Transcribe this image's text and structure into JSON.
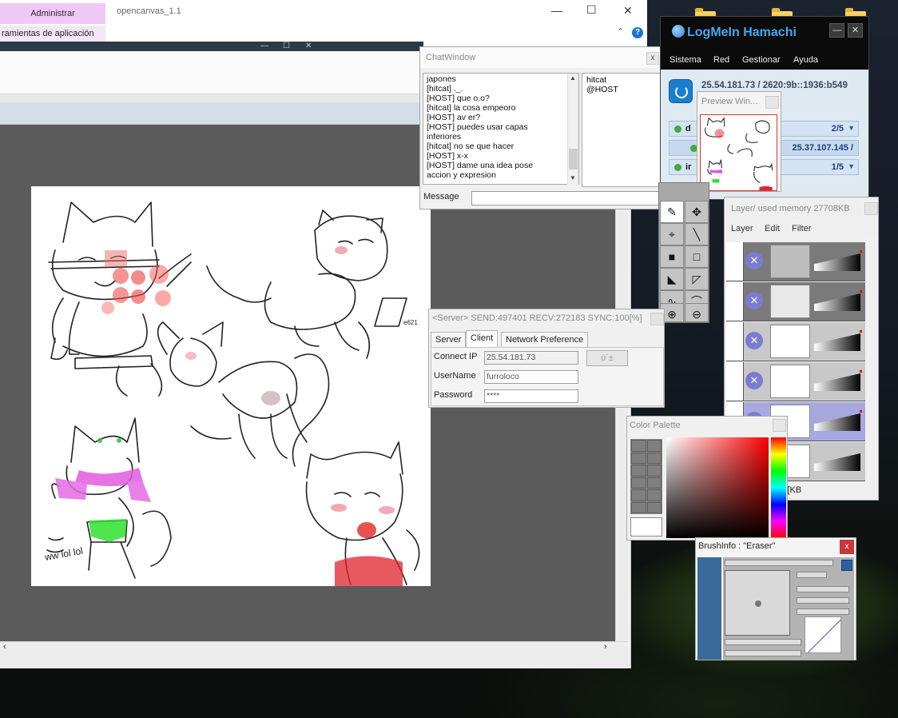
{
  "explorer": {
    "admin_tab": "Administrar",
    "sub_label": "ramientas de aplicación",
    "title": "opencanvas_1.1",
    "minimize": "—",
    "maximize": "☐",
    "close": "✕",
    "help": "?",
    "collapse": "⌃"
  },
  "chat": {
    "title": "ChatWindow",
    "close": "x",
    "messages": [
      "japones",
      "[hitcat] ._.",
      "[HOST]  que o.o?",
      "[hitcat] la cosa empeoro",
      "[HOST] av er?",
      "[HOST] puedes usar capas",
      "inferiores",
      "[hitcat] no se que hacer",
      "[HOST]  x-x",
      "[HOST] dame una idea pose",
      "accion y expresion"
    ],
    "users": [
      "hitcat",
      "@HOST"
    ],
    "message_label": "Message",
    "message_value": ""
  },
  "hamachi": {
    "brand": "LogMeIn Hamachi",
    "minimize": "—",
    "close": "✕",
    "menu": [
      "Sistema",
      "Red",
      "Gestionar",
      "Ayuda"
    ],
    "ip": "25.54.181.73 / 2620:9b::1936:b549",
    "networks": [
      {
        "name": "d",
        "count": "2/5"
      },
      {
        "name": "",
        "count": "25.37.107.145 /"
      },
      {
        "name": "ir",
        "count": "1/5"
      }
    ]
  },
  "preview": {
    "title": "Preview Win..."
  },
  "layers": {
    "title": "Layer/ used memory 27708KB",
    "menu": [
      "Layer",
      "Edit",
      "Filter"
    ],
    "status": "B] / Undo: 3072[KB"
  },
  "server": {
    "title": "<Server> SEND:497401 RECV:272183 SYNC:100[%]",
    "tabs": [
      "Server",
      "Client",
      "Network Preference"
    ],
    "connect_ip_label": "Connect IP",
    "connect_ip_value": "25.54.181.73",
    "connect_button": "ú´±",
    "username_label": "UserName",
    "username_value": "furroloco",
    "password_label": "Password",
    "password_value": "****"
  },
  "palette": {
    "title": "Color Palette"
  },
  "brush": {
    "title": "BrushInfo : \"Eraser\"",
    "close": "x"
  },
  "canvas": {
    "signature": "e621",
    "doodle": "ww lol lol"
  }
}
